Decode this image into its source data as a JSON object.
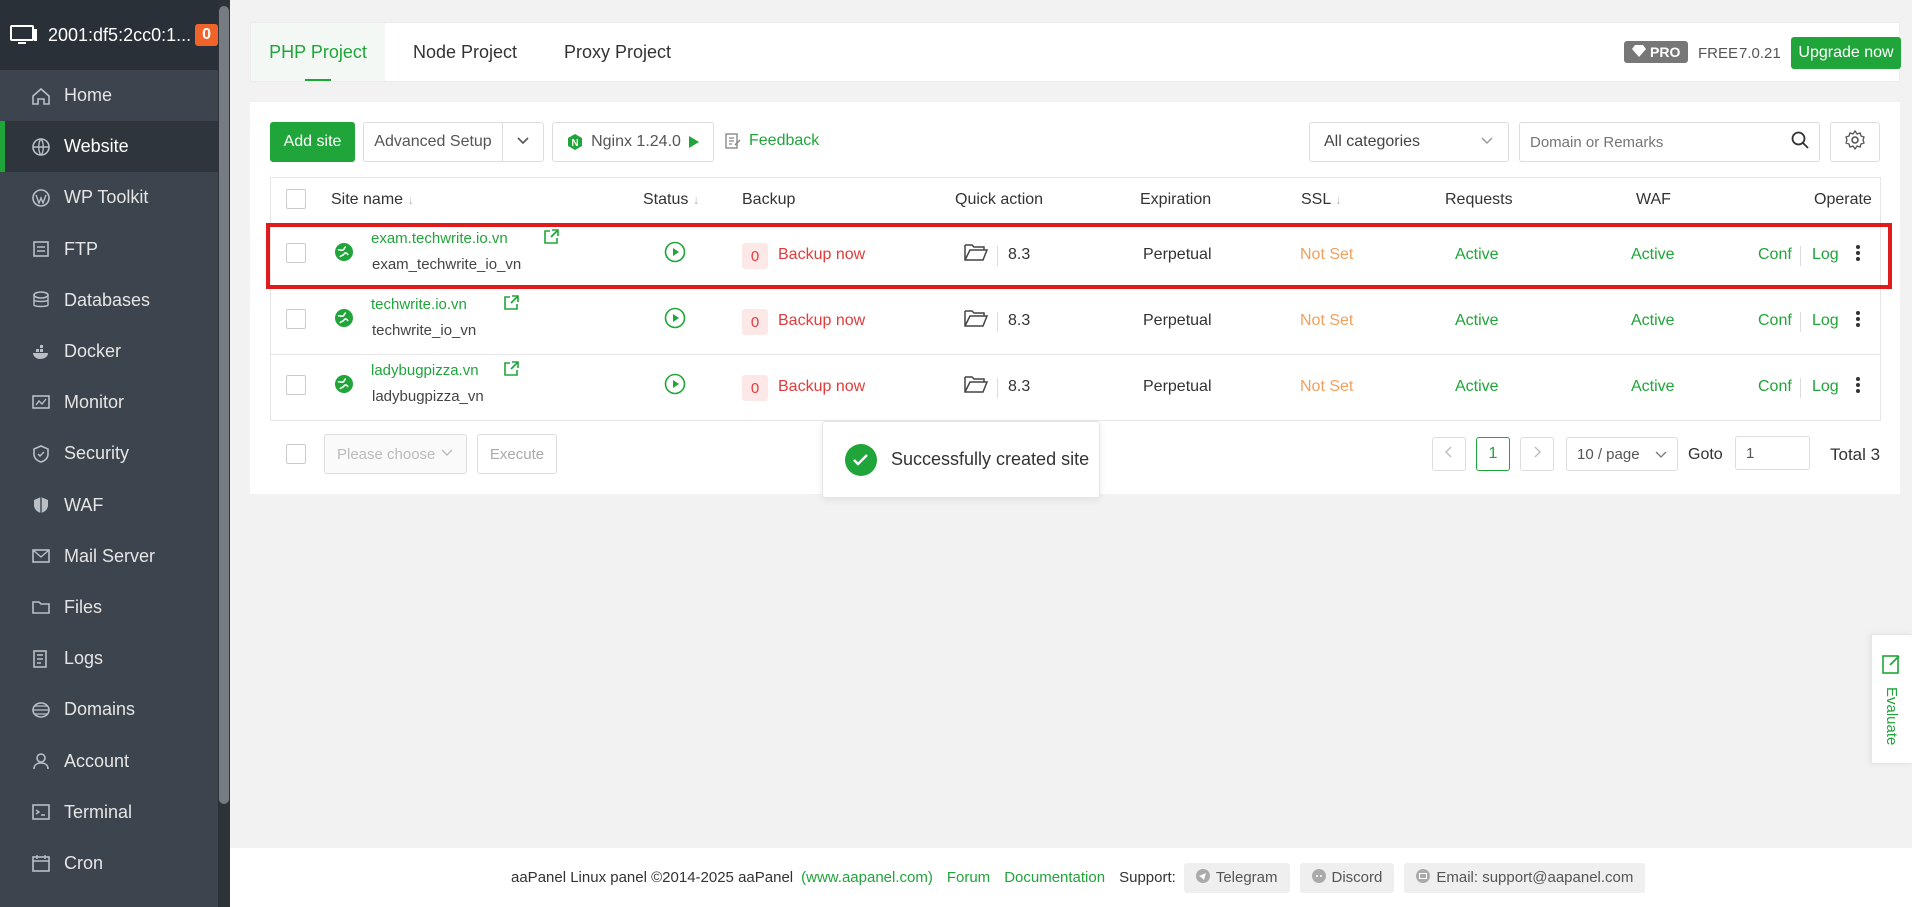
{
  "sidebar": {
    "host": "2001:df5:2cc0:1...",
    "badge": "0",
    "items": [
      {
        "label": "Home",
        "icon": "home-icon"
      },
      {
        "label": "Website",
        "icon": "globe-icon",
        "active": true
      },
      {
        "label": "WP Toolkit",
        "icon": "wordpress-icon"
      },
      {
        "label": "FTP",
        "icon": "ftp-icon"
      },
      {
        "label": "Databases",
        "icon": "database-icon"
      },
      {
        "label": "Docker",
        "icon": "docker-icon"
      },
      {
        "label": "Monitor",
        "icon": "monitor-icon"
      },
      {
        "label": "Security",
        "icon": "shield-icon"
      },
      {
        "label": "WAF",
        "icon": "waf-shield-icon"
      },
      {
        "label": "Mail Server",
        "icon": "mail-icon"
      },
      {
        "label": "Files",
        "icon": "folder-icon"
      },
      {
        "label": "Logs",
        "icon": "logs-icon"
      },
      {
        "label": "Domains",
        "icon": "domains-icon"
      },
      {
        "label": "Account",
        "icon": "user-icon"
      },
      {
        "label": "Terminal",
        "icon": "terminal-icon"
      },
      {
        "label": "Cron",
        "icon": "calendar-icon"
      }
    ]
  },
  "tabs": [
    {
      "label": "PHP Project",
      "active": true
    },
    {
      "label": "Node Project"
    },
    {
      "label": "Proxy Project"
    }
  ],
  "header": {
    "pro_label": "PRO",
    "free_label": "FREE",
    "version": "7.0.21",
    "upgrade_label": "Upgrade now"
  },
  "toolbar": {
    "add_site": "Add site",
    "advanced_setup": "Advanced Setup",
    "nginx": "Nginx 1.24.0",
    "feedback": "Feedback",
    "category": "All categories",
    "search_placeholder": "Domain or Remarks"
  },
  "table": {
    "headers": {
      "site_name": "Site name",
      "status": "Status",
      "backup": "Backup",
      "quick_action": "Quick action",
      "expiration": "Expiration",
      "ssl": "SSL",
      "requests": "Requests",
      "waf": "WAF",
      "operate": "Operate"
    },
    "rows": [
      {
        "domain": "exam.techwrite.io.vn",
        "sub": "exam_techwrite_io_vn",
        "backup_count": "0",
        "backup_label": "Backup now",
        "php": "8.3",
        "expiration": "Perpetual",
        "ssl": "Not Set",
        "requests": "Active",
        "waf": "Active",
        "conf": "Conf",
        "log": "Log"
      },
      {
        "domain": "techwrite.io.vn",
        "sub": "techwrite_io_vn",
        "backup_count": "0",
        "backup_label": "Backup now",
        "php": "8.3",
        "expiration": "Perpetual",
        "ssl": "Not Set",
        "requests": "Active",
        "waf": "Active",
        "conf": "Conf",
        "log": "Log"
      },
      {
        "domain": "ladybugpizza.vn",
        "sub": "ladybugpizza_vn",
        "backup_count": "0",
        "backup_label": "Backup now",
        "php": "8.3",
        "expiration": "Perpetual",
        "ssl": "Not Set",
        "requests": "Active",
        "waf": "Active",
        "conf": "Conf",
        "log": "Log"
      }
    ]
  },
  "bulk": {
    "placeholder": "Please choose",
    "execute": "Execute"
  },
  "pagination": {
    "current_page": "1",
    "per_page": "10 / page",
    "goto_label": "Goto",
    "goto_value": "1",
    "total": "Total 3"
  },
  "toast": {
    "message": "Successfully created site"
  },
  "footer": {
    "copyright": "aaPanel Linux panel ©2014-2025 aaPanel",
    "site_link": "(www.aapanel.com)",
    "forum": "Forum",
    "documentation": "Documentation",
    "support_label": "Support:",
    "telegram": "Telegram",
    "discord": "Discord",
    "email": "Email: support@aapanel.com"
  },
  "evaluate": "Evaluate",
  "colors": {
    "accent": "#20a53a",
    "danger": "#e23b3b",
    "warning": "#f0a060",
    "sidebar": "#3c444d"
  }
}
